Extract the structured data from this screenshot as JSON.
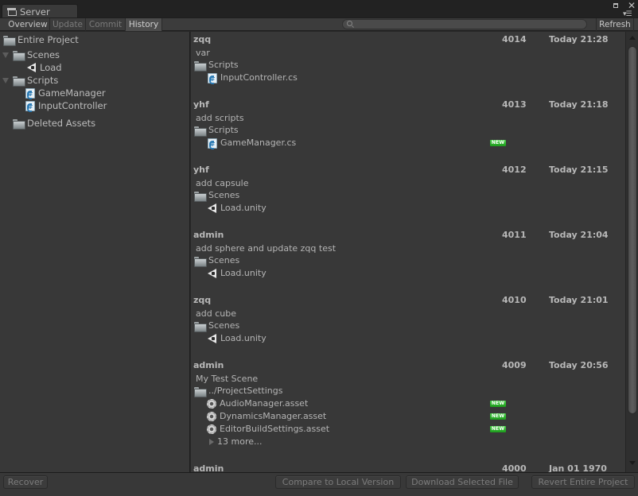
{
  "window": {
    "title": "Server",
    "title_icon": "server-icon",
    "controls": [
      "maximize-icon",
      "close-icon",
      "menu-icon"
    ]
  },
  "toolbar": {
    "tabs": [
      {
        "label": "Overview",
        "state": "normal"
      },
      {
        "label": "Update",
        "state": "disabled"
      },
      {
        "label": "Commit",
        "state": "disabled"
      },
      {
        "label": "History",
        "state": "active"
      }
    ],
    "search": {
      "value": "",
      "placeholder": ""
    },
    "refresh_label": "Refresh"
  },
  "tree": {
    "items": [
      {
        "label": "Entire Project",
        "icon": "folder-icon",
        "level": 0,
        "expandable": false
      },
      {
        "label": "Scenes",
        "icon": "folder-icon",
        "level": 0,
        "expanded": true
      },
      {
        "label": "Load",
        "icon": "unity-scene-icon",
        "level": 2
      },
      {
        "label": "Scripts",
        "icon": "folder-icon",
        "level": 0,
        "expanded": true
      },
      {
        "label": "GameManager",
        "icon": "csharp-script-icon",
        "level": 2
      },
      {
        "label": "InputController",
        "icon": "csharp-script-icon",
        "level": 2
      },
      {
        "label": "Deleted Assets",
        "icon": "folder-icon",
        "level": 1
      }
    ]
  },
  "history": {
    "new_badge_label": "NEW",
    "entries": [
      {
        "author": "zqq",
        "revision": "4014",
        "date": "Today 21:28",
        "message": "var",
        "folder": "Scripts",
        "files": [
          {
            "name": "InputController.cs",
            "icon": "csharp-script-icon",
            "new": false
          }
        ]
      },
      {
        "author": "yhf",
        "revision": "4013",
        "date": "Today 21:18",
        "message": "add scripts",
        "folder": "Scripts",
        "files": [
          {
            "name": "GameManager.cs",
            "icon": "csharp-script-icon",
            "new": true
          }
        ]
      },
      {
        "author": "yhf",
        "revision": "4012",
        "date": "Today 21:15",
        "message": "add capsule",
        "folder": "Scenes",
        "files": [
          {
            "name": "Load.unity",
            "icon": "unity-scene-icon",
            "new": false
          }
        ]
      },
      {
        "author": "admin",
        "revision": "4011",
        "date": "Today 21:04",
        "message": "add sphere and update zqq test",
        "folder": "Scenes",
        "files": [
          {
            "name": "Load.unity",
            "icon": "unity-scene-icon",
            "new": false
          }
        ]
      },
      {
        "author": "zqq",
        "revision": "4010",
        "date": "Today 21:01",
        "message": "add cube",
        "folder": "Scenes",
        "files": [
          {
            "name": "Load.unity",
            "icon": "unity-scene-icon",
            "new": false
          }
        ]
      },
      {
        "author": "admin",
        "revision": "4009",
        "date": "Today 20:56",
        "message": "My Test Scene",
        "folder": "../ProjectSettings",
        "files": [
          {
            "name": "AudioManager.asset",
            "icon": "gear-icon",
            "new": true
          },
          {
            "name": "DynamicsManager.asset",
            "icon": "gear-icon",
            "new": true
          },
          {
            "name": "EditorBuildSettings.asset",
            "icon": "gear-icon",
            "new": true
          }
        ],
        "more_label": "13 more..."
      },
      {
        "author": "admin",
        "revision": "4000",
        "date": "Jan 01 1970",
        "message": "",
        "folder": "",
        "files": []
      }
    ]
  },
  "bottom": {
    "recover_label": "Recover",
    "compare_label": "Compare to Local Version",
    "download_label": "Download Selected File",
    "revert_label": "Revert Entire Project"
  }
}
